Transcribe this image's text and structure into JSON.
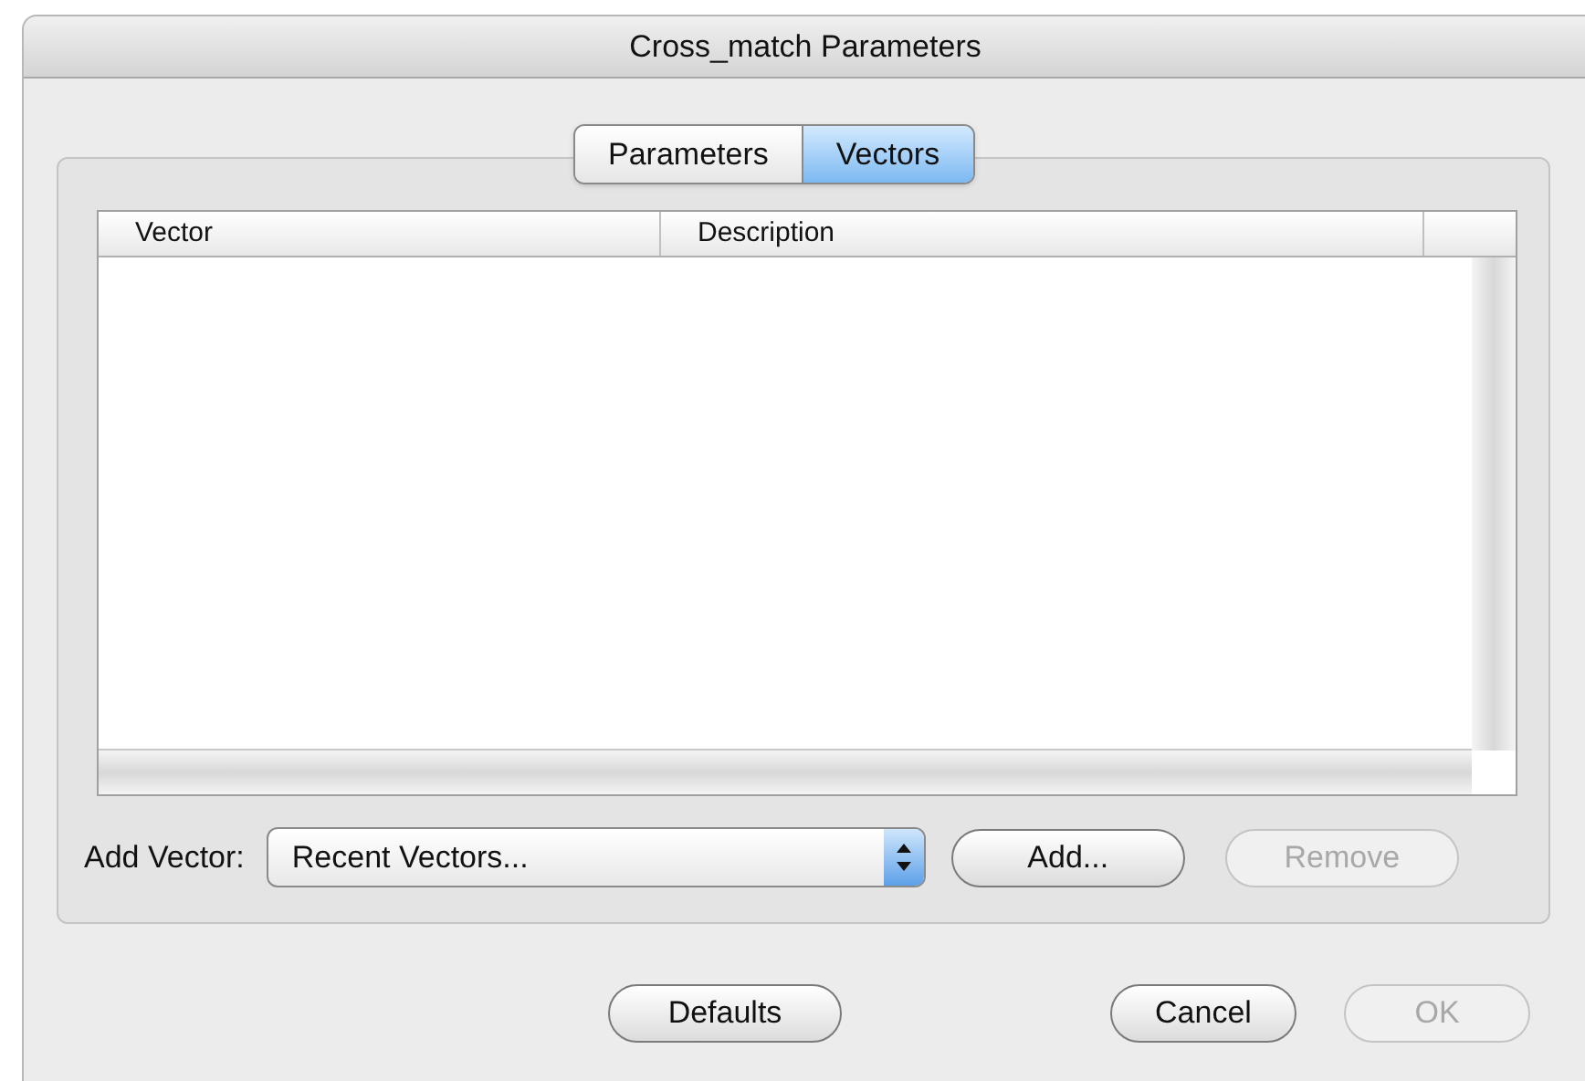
{
  "window": {
    "title": "Cross_match Parameters"
  },
  "tabs": [
    {
      "label": "Parameters",
      "selected": false
    },
    {
      "label": "Vectors",
      "selected": true
    }
  ],
  "table": {
    "columns": [
      "Vector",
      "Description"
    ]
  },
  "add_vector": {
    "label": "Add Vector:",
    "popup": "Recent Vectors...",
    "buttons": [
      {
        "label": "Add...",
        "disabled": false
      },
      {
        "label": "Remove",
        "disabled": true
      }
    ]
  },
  "footer": {
    "left_buttons": [
      {
        "label": "Defaults",
        "disabled": false
      }
    ],
    "right_buttons": [
      {
        "label": "Cancel",
        "disabled": false
      },
      {
        "label": "OK",
        "disabled": true
      }
    ]
  }
}
